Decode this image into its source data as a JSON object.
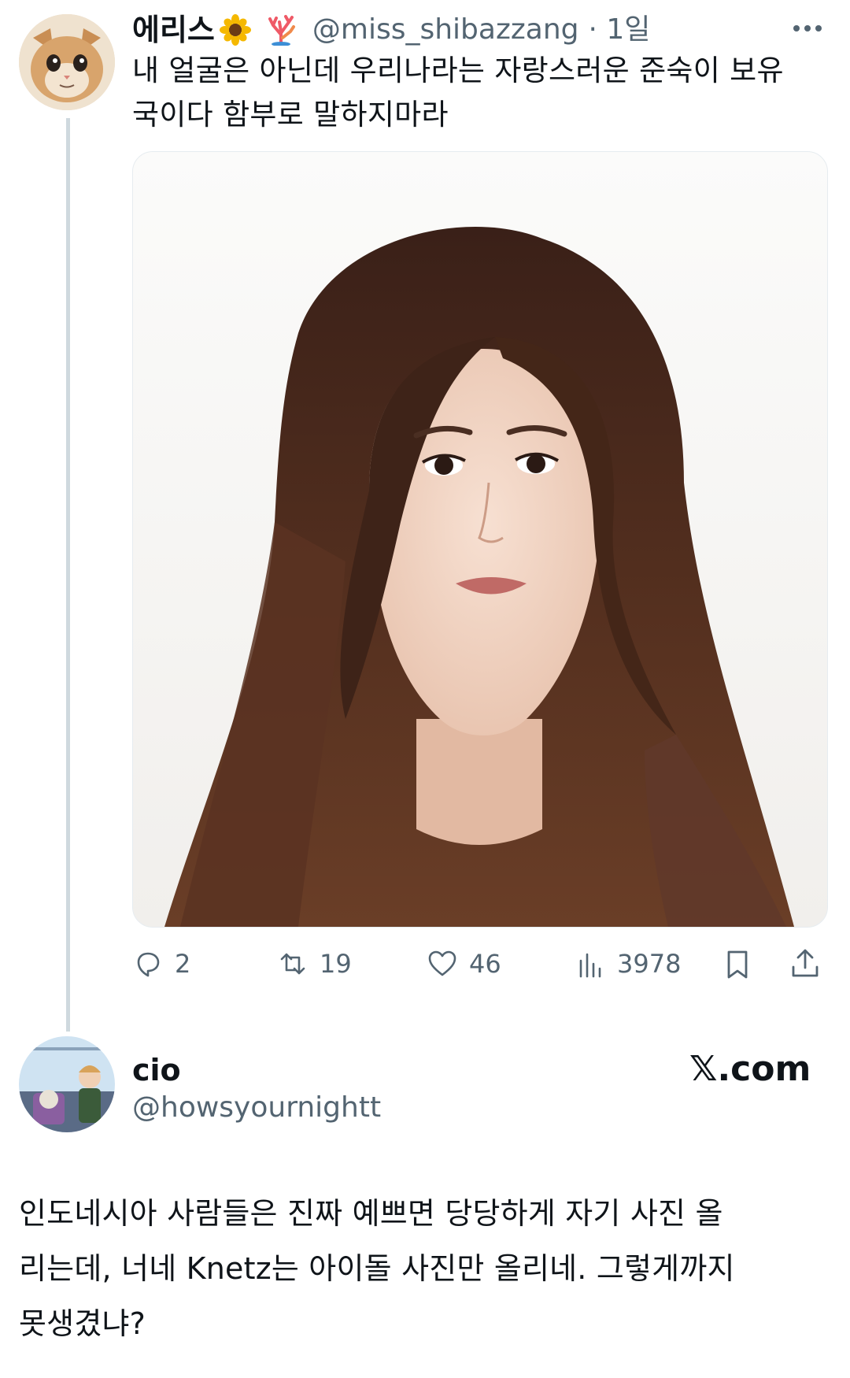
{
  "tweet": {
    "display_name": "에리스",
    "name_emojis": [
      "sunflower-emoji",
      "coral-emoji"
    ],
    "handle": "@miss_shibazzang",
    "time": "· 1일",
    "more_icon": "more-icon",
    "text_line1": "내 얼굴은 아닌데 우리나라는 자랑스러운 준숙이 보유",
    "text_line2": "국이다 함부로 말하지마라",
    "actions": {
      "reply_count": "2",
      "retweet_count": "19",
      "like_count": "46",
      "view_count": "3978"
    }
  },
  "reply": {
    "display_name": "cio",
    "handle": "@howsyournightt",
    "brand": "𝕏.com",
    "text_line1": "인도네시아 사람들은 진짜 예쁘면 당당하게 자기 사진 올",
    "text_line2": "리는데, 너네 Knetz는 아이돌 사진만 올리네. 그렇게까지",
    "text_line3": "못생겼냐?"
  },
  "colors": {
    "text": "#0f1419",
    "secondary": "#536471",
    "thread_line": "#cfd9de",
    "hair": "#4a2a1c",
    "skin": "#f3d6c6"
  }
}
